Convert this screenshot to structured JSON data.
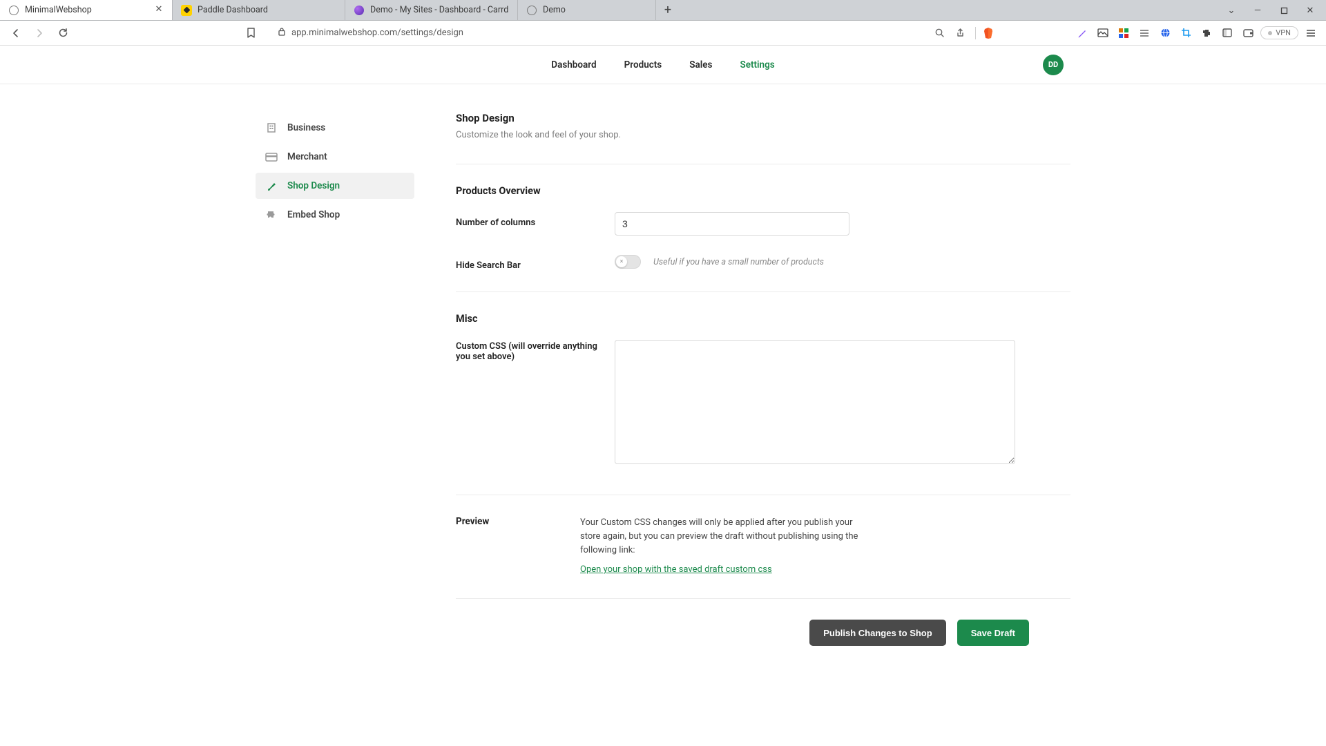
{
  "browser": {
    "tabs": [
      {
        "title": "MinimalWebshop",
        "active": true
      },
      {
        "title": "Paddle Dashboard",
        "active": false
      },
      {
        "title": "Demo - My Sites - Dashboard - Carrd",
        "active": false
      },
      {
        "title": "Demo",
        "active": false
      }
    ],
    "url": "app.minimalwebshop.com/settings/design",
    "vpn_label": "VPN"
  },
  "header": {
    "nav": [
      "Dashboard",
      "Products",
      "Sales",
      "Settings"
    ],
    "nav_active_index": 3,
    "avatar_initials": "DD"
  },
  "sidebar": {
    "items": [
      {
        "label": "Business",
        "icon": "building-icon"
      },
      {
        "label": "Merchant",
        "icon": "credit-card-icon"
      },
      {
        "label": "Shop Design",
        "icon": "brush-icon"
      },
      {
        "label": "Embed Shop",
        "icon": "puzzle-icon"
      }
    ],
    "active_index": 2
  },
  "page": {
    "title": "Shop Design",
    "subtitle": "Customize the look and feel of your shop."
  },
  "sections": {
    "products_overview": {
      "heading": "Products Overview",
      "num_columns_label": "Number of columns",
      "num_columns_value": "3",
      "hide_search_label": "Hide Search Bar",
      "hide_search_on": false,
      "hide_search_hint": "Useful if you have a small number of products"
    },
    "misc": {
      "heading": "Misc",
      "custom_css_label": "Custom CSS (will override anything you set above)",
      "custom_css_value": ""
    },
    "preview": {
      "heading": "Preview",
      "body": "Your Custom CSS changes will only be applied after you publish your store again, but you can preview the draft without publishing using the following link:",
      "link_text": "Open your shop with the saved draft custom css"
    }
  },
  "buttons": {
    "publish": "Publish Changes to Shop",
    "save_draft": "Save Draft"
  }
}
